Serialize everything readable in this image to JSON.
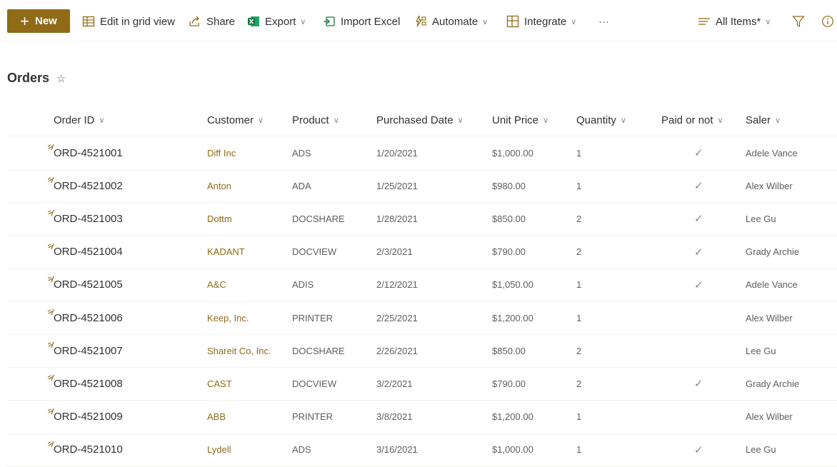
{
  "toolbar": {
    "new_label": "New",
    "edit_grid_label": "Edit in grid view",
    "share_label": "Share",
    "export_label": "Export",
    "import_label": "Import Excel",
    "automate_label": "Automate",
    "integrate_label": "Integrate",
    "more_label": "···",
    "view_label": "All Items*",
    "accent_color": "#8f6a17"
  },
  "list": {
    "title": "Orders",
    "columns": [
      "Order ID",
      "Customer",
      "Product",
      "Purchased Date",
      "Unit Price",
      "Quantity",
      "Paid or not",
      "Saler"
    ],
    "rows": [
      {
        "order_id": "ORD-4521001",
        "customer": "Diff Inc",
        "product": "ADS",
        "date": "1/20/2021",
        "price": "$1,000.00",
        "qty": "1",
        "paid": "✓",
        "saler": "Adele Vance"
      },
      {
        "order_id": "ORD-4521002",
        "customer": "Anton",
        "product": "ADA",
        "date": "1/25/2021",
        "price": "$980.00",
        "qty": "1",
        "paid": "✓",
        "saler": "Alex Wilber"
      },
      {
        "order_id": "ORD-4521003",
        "customer": "Dottm",
        "product": "DOCSHARE",
        "date": "1/28/2021",
        "price": "$850.00",
        "qty": "2",
        "paid": "✓",
        "saler": "Lee Gu"
      },
      {
        "order_id": "ORD-4521004",
        "customer": "KADANT",
        "product": "DOCVIEW",
        "date": "2/3/2021",
        "price": "$790.00",
        "qty": "2",
        "paid": "✓",
        "saler": "Grady Archie"
      },
      {
        "order_id": "ORD-4521005",
        "customer": "A&C",
        "product": "ADIS",
        "date": "2/12/2021",
        "price": "$1,050.00",
        "qty": "1",
        "paid": "✓",
        "saler": "Adele Vance"
      },
      {
        "order_id": "ORD-4521006",
        "customer": "Keep, Inc.",
        "product": "PRINTER",
        "date": "2/25/2021",
        "price": "$1,200.00",
        "qty": "1",
        "paid": "",
        "saler": "Alex Wilber"
      },
      {
        "order_id": "ORD-4521007",
        "customer": "Shareit Co, Inc.",
        "product": "DOCSHARE",
        "date": "2/26/2021",
        "price": "$850.00",
        "qty": "2",
        "paid": "",
        "saler": "Lee Gu"
      },
      {
        "order_id": "ORD-4521008",
        "customer": "CAST",
        "product": "DOCVIEW",
        "date": "3/2/2021",
        "price": "$790.00",
        "qty": "2",
        "paid": "✓",
        "saler": "Grady Archie"
      },
      {
        "order_id": "ORD-4521009",
        "customer": "ABB",
        "product": "PRINTER",
        "date": "3/8/2021",
        "price": "$1,200.00",
        "qty": "1",
        "paid": "",
        "saler": "Alex Wilber"
      },
      {
        "order_id": "ORD-4521010",
        "customer": "Lydell",
        "product": "ADS",
        "date": "3/16/2021",
        "price": "$1,000.00",
        "qty": "1",
        "paid": "✓",
        "saler": "Lee Gu"
      }
    ]
  }
}
